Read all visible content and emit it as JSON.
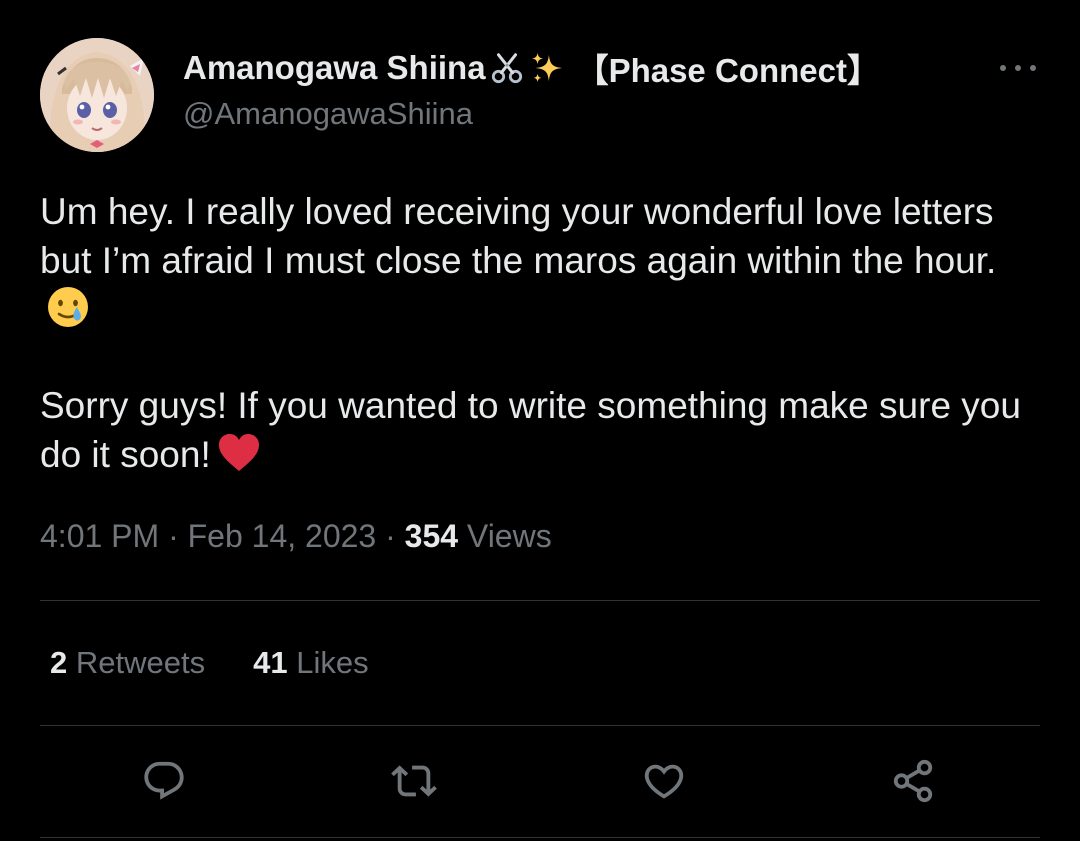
{
  "author": {
    "display_name": "Amanogawa Shiina",
    "name_emojis": [
      "scissors-emoji",
      "sparkles-emoji"
    ],
    "org_tag": "【Phase Connect】",
    "handle": "@AmanogawaShiina",
    "avatar": "anime-girl-avatar"
  },
  "tweet": {
    "paragraph1": "Um hey. I really loved receiving your wonderful love letters but I’m afraid I must close the maros again within the hour.",
    "paragraph1_emoji": "crying-smile-emoji",
    "paragraph2": "Sorry guys! If you wanted to write something make sure you do it soon!",
    "paragraph2_emoji": "red-heart-emoji"
  },
  "meta": {
    "time": "4:01 PM",
    "sep1": "·",
    "date": "Feb 14, 2023",
    "sep2": "·",
    "views_count": "354",
    "views_label": "Views"
  },
  "stats": {
    "retweets_count": "2",
    "retweets_label": "Retweets",
    "likes_count": "41",
    "likes_label": "Likes"
  },
  "actions": [
    "reply-icon",
    "retweet-icon",
    "like-icon",
    "share-icon"
  ],
  "colors": {
    "background": "#000000",
    "primary_text": "#e7e9ea",
    "secondary_text": "#71767b",
    "divider": "#2f3336",
    "heart": "#e0245e"
  }
}
